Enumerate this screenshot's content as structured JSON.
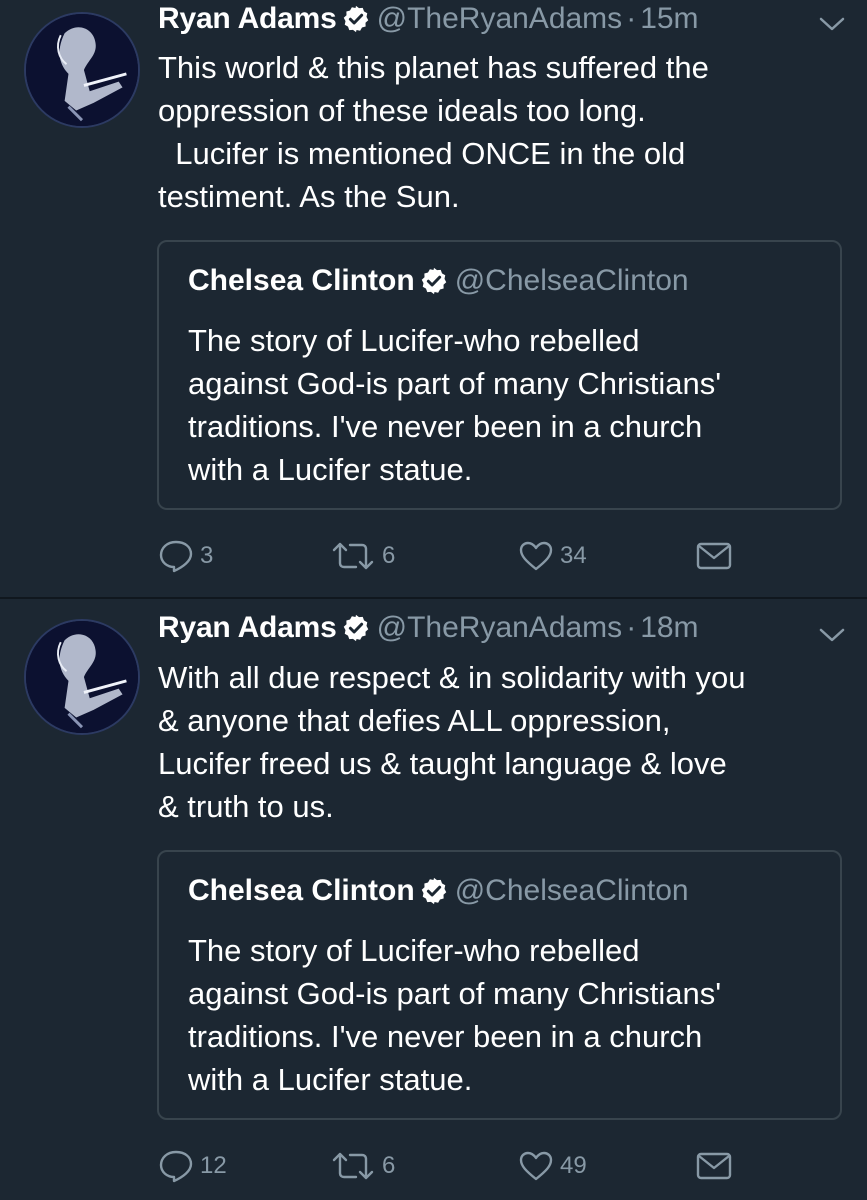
{
  "colors": {
    "background": "#1c2732",
    "divider": "#10171e",
    "secondary_text": "#8899a6",
    "border": "#38444d"
  },
  "tweets": [
    {
      "author_name": "Ryan Adams",
      "author_handle": "@TheRyanAdams",
      "separator": "·",
      "time": "15m",
      "text": "This world & this planet has suffered the\noppression of these ideals too long.\n  Lucifer is mentioned ONCE in the old\ntestiment. As the Sun.",
      "quoted": {
        "author_name": "Chelsea Clinton",
        "author_handle": "@ChelseaClinton",
        "text": "The story of Lucifer-who rebelled\nagainst God-is part of many Christians'\ntraditions. I've never been in a church\nwith a Lucifer statue."
      },
      "replies": "3",
      "retweets": "6",
      "likes": "34"
    },
    {
      "author_name": "Ryan Adams",
      "author_handle": "@TheRyanAdams",
      "separator": "·",
      "time": "18m",
      "text": "With all due respect & in solidarity with you\n& anyone that defies ALL oppression,\nLucifer freed us & taught language & love\n& truth to us.",
      "quoted": {
        "author_name": "Chelsea Clinton",
        "author_handle": "@ChelseaClinton",
        "text": "The story of Lucifer-who rebelled\nagainst God-is part of many Christians'\ntraditions. I've never been in a church\nwith a Lucifer statue."
      },
      "replies": "12",
      "retweets": "6",
      "likes": "49"
    }
  ],
  "icons": [
    "avatar",
    "verified-icon",
    "caret-down-icon",
    "reply-icon",
    "retweet-icon",
    "like-icon",
    "direct-message-icon"
  ]
}
